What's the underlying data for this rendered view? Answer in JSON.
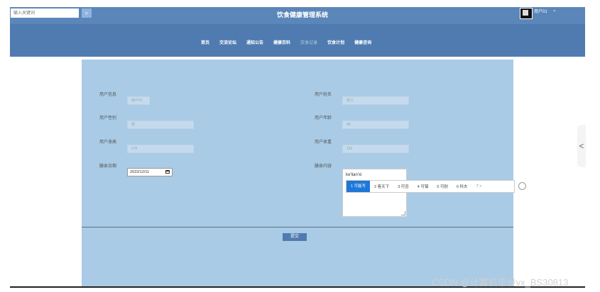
{
  "colors": {
    "header": "#5b86b9",
    "nav_bar": "#4f7bb0",
    "panel": "#a9cbe6",
    "ime_selected": "#1e78d7"
  },
  "search": {
    "placeholder": "输入关键词",
    "button_icon": "search-icon"
  },
  "app_title": "饮食健康管理系统",
  "user": {
    "name": "用户01",
    "caret": "⌄"
  },
  "nav": [
    "首页",
    "交流论坛",
    "通知公告",
    "健康百科",
    "饮食记录",
    "饮食计划",
    "健康咨询"
  ],
  "form": {
    "user_account": {
      "label": "用户信息",
      "value": "用户01"
    },
    "user_name": {
      "label": "用户姓名",
      "value": "张三"
    },
    "gender": {
      "label": "用户性别",
      "value": "男"
    },
    "age": {
      "label": "用户年龄",
      "value": "58"
    },
    "height": {
      "label": "用户身高",
      "value": "175"
    },
    "weight": {
      "label": "用户体重",
      "value": "150"
    },
    "diet_date": {
      "label": "膳食日期",
      "value": "2023/12/11"
    },
    "diet_content": {
      "label": "膳食内容",
      "typed": "ke'lian'xi"
    },
    "submit": "提交"
  },
  "ime": {
    "candidates": [
      "1 可能写",
      "2 客天下",
      "3 可否",
      "4 可镇",
      "5 可耐",
      "6 科夫",
      "7 >"
    ]
  },
  "side_tab_icon": "<",
  "watermark": "CSDN @计算机毕设vx_BS30813"
}
